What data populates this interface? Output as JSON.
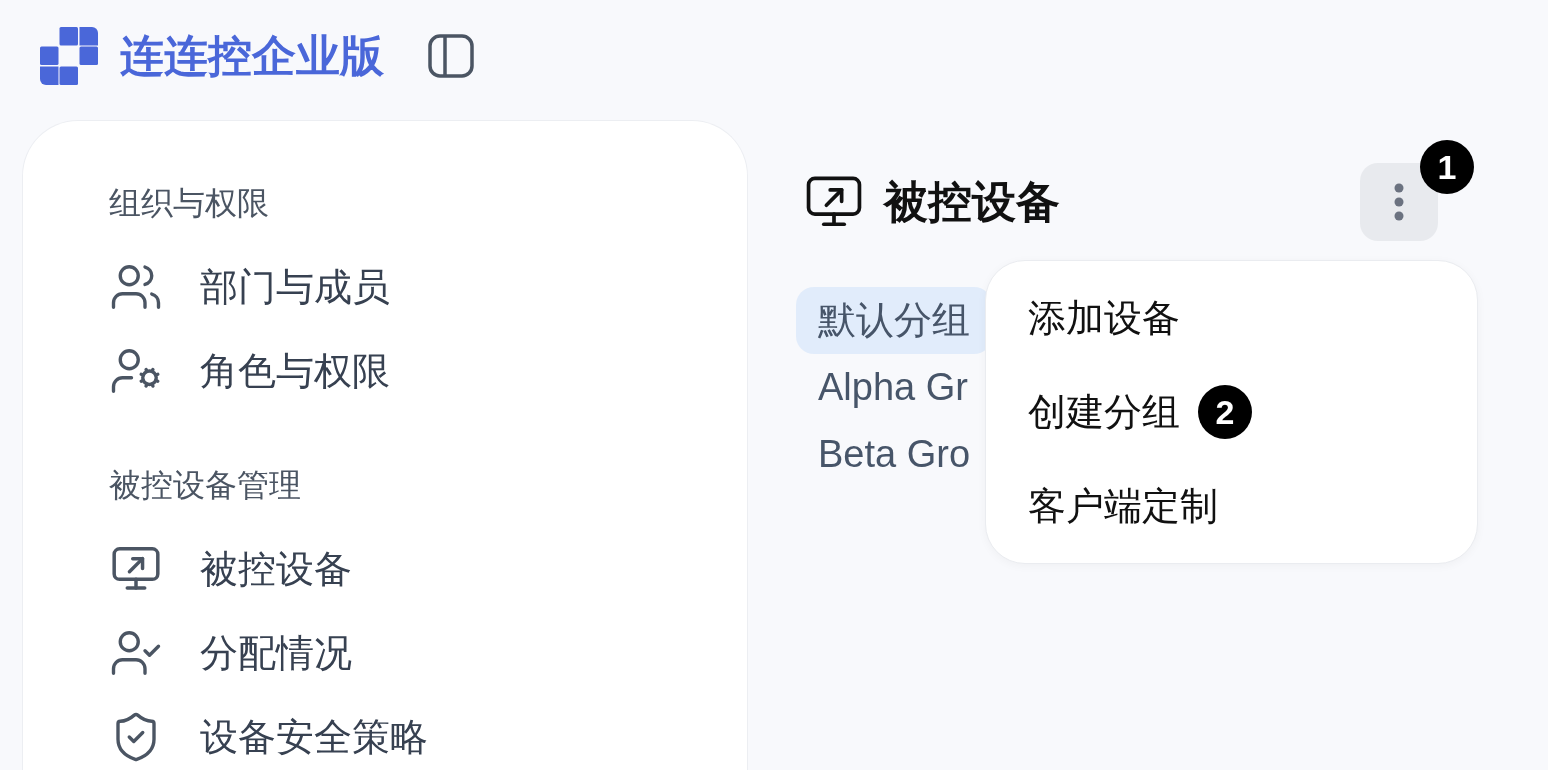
{
  "header": {
    "product_name": "连连控企业版"
  },
  "sidebar": {
    "sections": [
      {
        "title": "组织与权限",
        "items": [
          {
            "label": "部门与成员"
          },
          {
            "label": "角色与权限"
          }
        ]
      },
      {
        "title": "被控设备管理",
        "items": [
          {
            "label": "被控设备"
          },
          {
            "label": "分配情况"
          },
          {
            "label": "设备安全策略"
          }
        ]
      }
    ]
  },
  "main": {
    "title": "被控设备",
    "more_button": {
      "expanded": true,
      "badge": "1"
    },
    "groups": [
      {
        "label": "默认分组",
        "selected": true
      },
      {
        "label": "Alpha Gr",
        "selected": false
      },
      {
        "label": "Beta Gro",
        "selected": false
      }
    ]
  },
  "dropdown_menu": {
    "items": [
      {
        "label": "添加设备"
      },
      {
        "label": "创建分组",
        "badge": "2"
      },
      {
        "label": "客户端定制"
      }
    ]
  }
}
